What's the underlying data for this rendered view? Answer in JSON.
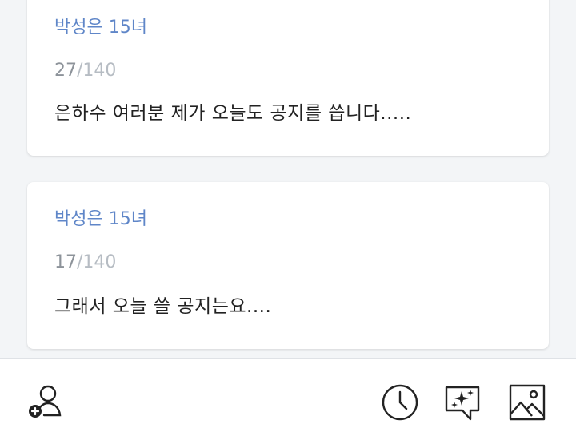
{
  "posts": [
    {
      "author": "박성은 15녀",
      "count_current": "27",
      "count_max": "/140",
      "content": "은하수 여러분 제가 오늘도 공지를 씁니다....."
    },
    {
      "author": "박성은 15녀",
      "count_current": "17",
      "count_max": "/140",
      "content": "그래서 오늘 쓸 공지는요...."
    }
  ],
  "toolbar": {
    "icons": [
      "add-user-icon",
      "clock-icon",
      "sticker-icon",
      "image-icon"
    ]
  },
  "colors": {
    "author": "#5f86c8",
    "counter_current": "#8d939a",
    "counter_max": "#b6bcc3",
    "background": "#f3f5f7"
  }
}
